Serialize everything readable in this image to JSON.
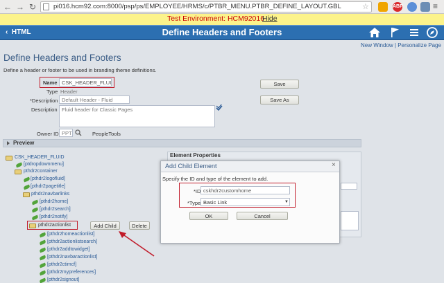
{
  "browser": {
    "url": "pi016.hcm92.com:8000/psp/ps/EMPLOYEE/HRMS/c/PTBR_MENU.PTBR_DEFINE_LAYOUT.GBL",
    "extensions": [
      "ABP"
    ]
  },
  "environment": {
    "text": "Test Environment: HCM92016",
    "hide_label": "Hide"
  },
  "header": {
    "back_label": "HTML",
    "title": "Define Headers and Footers"
  },
  "toplinks": {
    "new_window": "New Window",
    "separator": " | ",
    "personalize": "Personalize Page"
  },
  "page": {
    "heading": "Define Headers and Footers",
    "description": "Define a header or footer to be used in branding theme definitions.",
    "name_label": "Name",
    "name_value": "CSK_HEADER_FLUID",
    "type_label": "Type",
    "type_value": "Header",
    "description_label": "*Description",
    "description_value": "Default Header - Fluid",
    "long_description_label": "Description",
    "long_description_value": "Fluid header for Classic Pages",
    "owner_label": "Owner ID",
    "owner_value": "PPT",
    "owner_desc": "PeopleTools",
    "save_label": "Save",
    "save_as_label": "Save As",
    "preview_label": "Preview"
  },
  "tree": {
    "root": "CSK_HEADER_FLUID",
    "items": [
      "[ptdropdownmenu]",
      "pthdr2container",
      "[pthdr2logofluid]",
      "[pthdr2pagetitle]",
      "pthdr2navbarlinks",
      "[pthdr2home]",
      "[pthdr2search]",
      "[pthdr2notify]",
      "pthdr2actionlist",
      "[pthdr2homeactionlist]",
      "[pthdr2actionlistsearch]",
      "[pthdr2addtowidget]",
      "[pthdr2navbaractionlist]",
      "[pthdr2ctimcf]",
      "[pthdr2mypreferences]",
      "[pthdr2signout]"
    ],
    "add_child_label": "Add Child",
    "delete_label": "Delete"
  },
  "props": {
    "title": "Element Properties"
  },
  "modal": {
    "title": "Add Child Element",
    "description": "Specify the ID and type of the element to add.",
    "id_label": "*ID",
    "id_value": "cskhdr2customhome",
    "type_label": "*Type",
    "type_value": "Basic Link",
    "ok_label": "OK",
    "cancel_label": "Cancel"
  },
  "colors": {
    "nav": "#2c6fb1",
    "banner": "#fcf38b",
    "highlight": "#c11b2a"
  }
}
